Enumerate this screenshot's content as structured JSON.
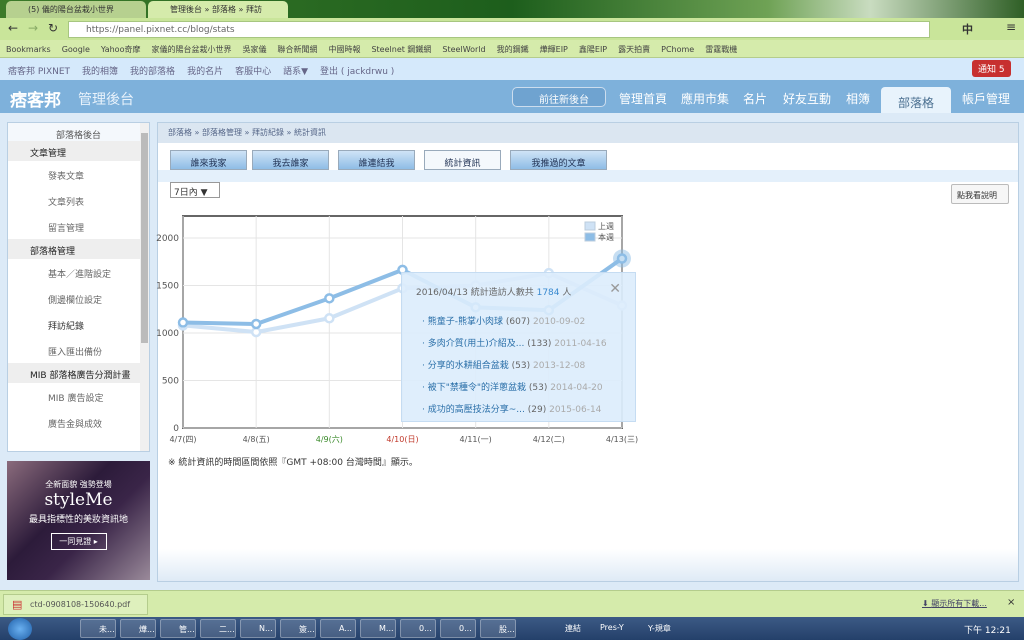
{
  "browser": {
    "tabs": [
      {
        "label": "(5) 儀的陽台盆栽小世界"
      },
      {
        "label": "管理後台 » 部落格 » 拜訪"
      }
    ],
    "url": "https://panel.pixnet.cc/blog/stats",
    "bookmarks": [
      "Bookmarks",
      "Google",
      "Yahoo奇摩",
      "家儀的陽台盆栽小世界",
      "吳家儀",
      "聯合新聞網",
      "中國時報",
      "Steelnet 鋼鐵網",
      "SteelWorld",
      "我的鋼鐵",
      "燁輝EIP",
      "鑫陽EIP",
      "露天拍賣",
      "PChome",
      "雷霆戰機"
    ]
  },
  "topnav": {
    "links": [
      "痞客邦 PIXNET",
      "我的相簿",
      "我的部落格",
      "我的名片",
      "客服中心",
      "語系▼",
      "登出 ( jackdrwu )"
    ],
    "notify": "通知 5"
  },
  "header": {
    "logo": "痞客邦",
    "title": "管理後台",
    "new_backend": "前往新後台",
    "nav": [
      "管理首頁",
      "應用市集",
      "名片",
      "好友互動",
      "相簿",
      "部落格",
      "帳戶管理"
    ]
  },
  "sidebar": {
    "title": "部落格後台",
    "sections": [
      {
        "label": "文章管理",
        "items": [
          "發表文章",
          "文章列表",
          "留言管理"
        ]
      },
      {
        "label": "部落格管理",
        "items": [
          "基本／進階設定",
          "側邊欄位設定",
          "拜訪紀錄",
          "匯入匯出備份"
        ]
      },
      {
        "label": "MIB 部落格廣告分潤計畫",
        "items": [
          "MIB 廣告設定",
          "廣告金與成效"
        ]
      }
    ]
  },
  "ad": {
    "line1": "全新面貌 強勢登場",
    "brand": "styleMe",
    "line2": "最具指標性的美妝資訊地",
    "cta": "一同見證 ▸"
  },
  "breadcrumb": [
    "部落格",
    "部落格管理",
    "拜訪紀錄",
    "統計資訊"
  ],
  "tabs": [
    "誰來我家",
    "我去誰家",
    "誰連結我",
    "統計資訊",
    "我推過的文章"
  ],
  "range": "7日內 ▼",
  "help": "點我看說明",
  "note": "※ 統計資訊的時間區間依照『GMT +08:00 台灣時間』顯示。",
  "tooltip": {
    "prefix": "2016/04/13 統計造訪人數共",
    "count": "1784",
    "suffix": "人",
    "items": [
      {
        "t": "熊童子-熊掌小肉球",
        "n": "(607)",
        "d": "2010-09-02"
      },
      {
        "t": "多肉介質(用土)介紹及...",
        "n": "(133)",
        "d": "2011-04-16"
      },
      {
        "t": "分享的水耕組合盆栽",
        "n": "(53)",
        "d": "2013-12-08"
      },
      {
        "t": "被下\"禁種令\"的洋蔥盆栽",
        "n": "(53)",
        "d": "2014-04-20"
      },
      {
        "t": "成功的高壓技法分享~...",
        "n": "(29)",
        "d": "2015-06-14"
      }
    ]
  },
  "chart_data": {
    "type": "line",
    "categories": [
      "4/7(四)",
      "4/8(五)",
      "4/9(六)",
      "4/10(日)",
      "4/11(一)",
      "4/12(二)",
      "4/13(三)"
    ],
    "category_colors": [
      "#555",
      "#555",
      "#3a8a2a",
      "#c0392b",
      "#555",
      "#555",
      "#555"
    ],
    "ylim": [
      0,
      2000
    ],
    "yticks": [
      0,
      500,
      1000,
      1500,
      2000
    ],
    "legend": "top-right",
    "series": [
      {
        "name": "上週",
        "color": "#cfe2f5",
        "values": [
          1080,
          1010,
          1155,
          1470,
          1500,
          1630,
          1290
        ]
      },
      {
        "name": "本週",
        "color": "#8dbde6",
        "values": [
          1110,
          1095,
          1365,
          1665,
          1270,
          1240,
          1784
        ]
      }
    ]
  },
  "download": {
    "file": "ctd-0908108-150640.pdf",
    "show_all": "顯示所有下載..."
  },
  "taskbar": {
    "items": [
      "未...",
      "燁...",
      "管...",
      "二...",
      "N...",
      "簽...",
      "A...",
      "M...",
      "0...",
      "0...",
      "股..."
    ],
    "links": "連結",
    "folders": [
      "Pres-Y",
      "Y-規章"
    ],
    "clock": "下午 12:21"
  }
}
